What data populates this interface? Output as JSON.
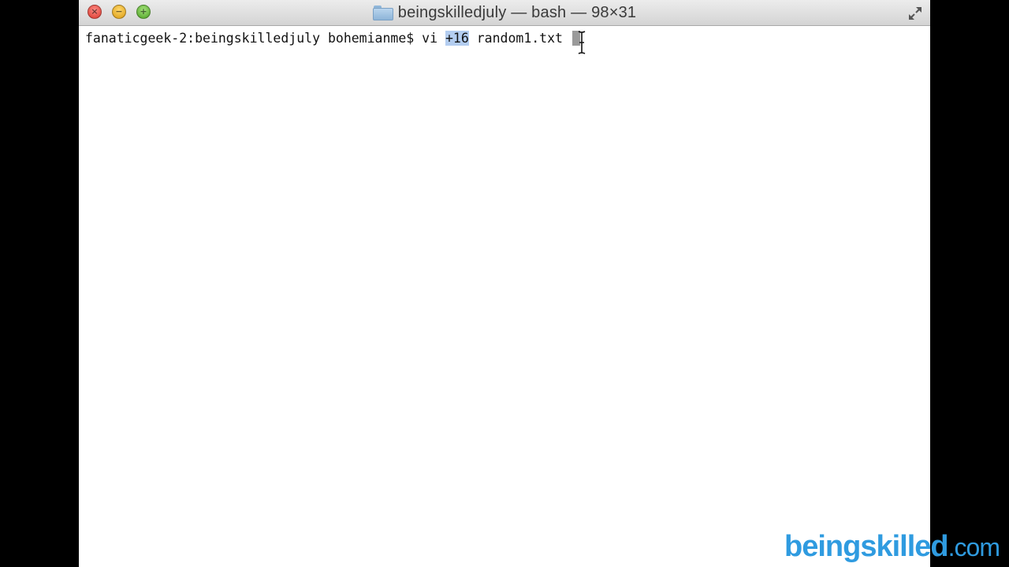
{
  "window": {
    "title": "beingskilledjuly — bash — 98×31"
  },
  "terminal": {
    "prompt": "fanaticgeek-2:beingskilledjuly bohemianme$ ",
    "command_before": "vi ",
    "command_selected": "+16",
    "command_after": " random1.txt "
  },
  "icons": {
    "close": "close-icon",
    "minimize": "minimize-icon",
    "zoom": "zoom-icon",
    "folder": "folder-icon",
    "fullscreen": "fullscreen-icon",
    "ibeam": "text-cursor-icon"
  },
  "colors": {
    "selection": "#b3cdf0",
    "watermark": "#2f9be0"
  },
  "watermark": {
    "main": "beingskilled",
    "tld": ".com"
  }
}
